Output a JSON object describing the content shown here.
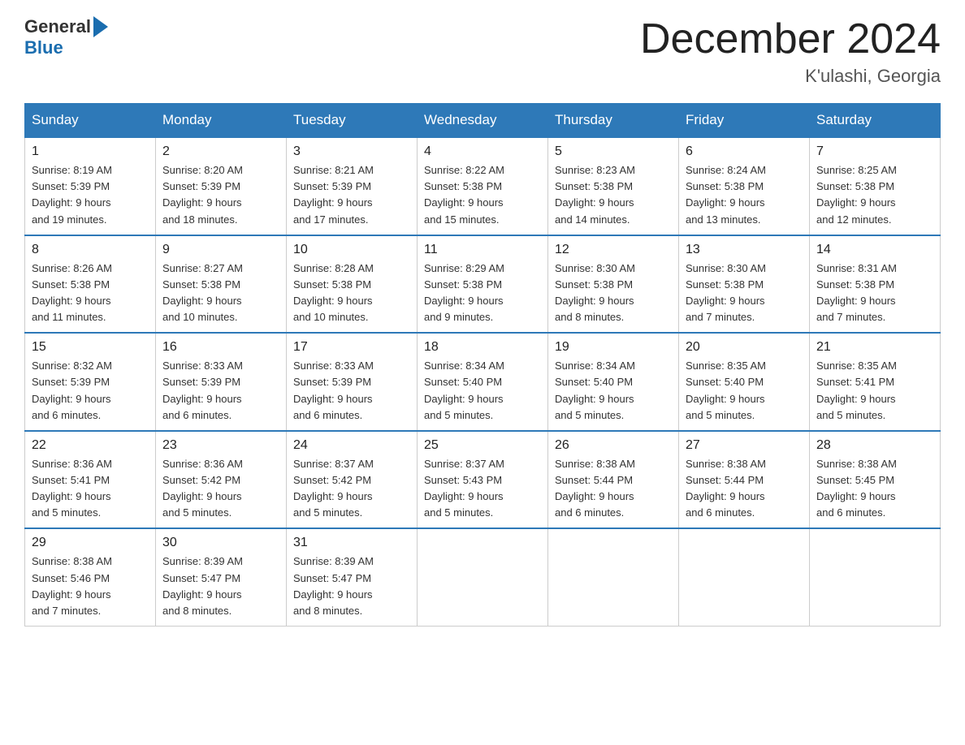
{
  "header": {
    "logo": {
      "text_general": "General",
      "text_blue": "Blue"
    },
    "title": "December 2024",
    "subtitle": "K'ulashi, Georgia"
  },
  "weekdays": [
    "Sunday",
    "Monday",
    "Tuesday",
    "Wednesday",
    "Thursday",
    "Friday",
    "Saturday"
  ],
  "weeks": [
    [
      {
        "day": "1",
        "sunrise": "8:19 AM",
        "sunset": "5:39 PM",
        "daylight": "9 hours and 19 minutes."
      },
      {
        "day": "2",
        "sunrise": "8:20 AM",
        "sunset": "5:39 PM",
        "daylight": "9 hours and 18 minutes."
      },
      {
        "day": "3",
        "sunrise": "8:21 AM",
        "sunset": "5:39 PM",
        "daylight": "9 hours and 17 minutes."
      },
      {
        "day": "4",
        "sunrise": "8:22 AM",
        "sunset": "5:38 PM",
        "daylight": "9 hours and 15 minutes."
      },
      {
        "day": "5",
        "sunrise": "8:23 AM",
        "sunset": "5:38 PM",
        "daylight": "9 hours and 14 minutes."
      },
      {
        "day": "6",
        "sunrise": "8:24 AM",
        "sunset": "5:38 PM",
        "daylight": "9 hours and 13 minutes."
      },
      {
        "day": "7",
        "sunrise": "8:25 AM",
        "sunset": "5:38 PM",
        "daylight": "9 hours and 12 minutes."
      }
    ],
    [
      {
        "day": "8",
        "sunrise": "8:26 AM",
        "sunset": "5:38 PM",
        "daylight": "9 hours and 11 minutes."
      },
      {
        "day": "9",
        "sunrise": "8:27 AM",
        "sunset": "5:38 PM",
        "daylight": "9 hours and 10 minutes."
      },
      {
        "day": "10",
        "sunrise": "8:28 AM",
        "sunset": "5:38 PM",
        "daylight": "9 hours and 10 minutes."
      },
      {
        "day": "11",
        "sunrise": "8:29 AM",
        "sunset": "5:38 PM",
        "daylight": "9 hours and 9 minutes."
      },
      {
        "day": "12",
        "sunrise": "8:30 AM",
        "sunset": "5:38 PM",
        "daylight": "9 hours and 8 minutes."
      },
      {
        "day": "13",
        "sunrise": "8:30 AM",
        "sunset": "5:38 PM",
        "daylight": "9 hours and 7 minutes."
      },
      {
        "day": "14",
        "sunrise": "8:31 AM",
        "sunset": "5:38 PM",
        "daylight": "9 hours and 7 minutes."
      }
    ],
    [
      {
        "day": "15",
        "sunrise": "8:32 AM",
        "sunset": "5:39 PM",
        "daylight": "9 hours and 6 minutes."
      },
      {
        "day": "16",
        "sunrise": "8:33 AM",
        "sunset": "5:39 PM",
        "daylight": "9 hours and 6 minutes."
      },
      {
        "day": "17",
        "sunrise": "8:33 AM",
        "sunset": "5:39 PM",
        "daylight": "9 hours and 6 minutes."
      },
      {
        "day": "18",
        "sunrise": "8:34 AM",
        "sunset": "5:40 PM",
        "daylight": "9 hours and 5 minutes."
      },
      {
        "day": "19",
        "sunrise": "8:34 AM",
        "sunset": "5:40 PM",
        "daylight": "9 hours and 5 minutes."
      },
      {
        "day": "20",
        "sunrise": "8:35 AM",
        "sunset": "5:40 PM",
        "daylight": "9 hours and 5 minutes."
      },
      {
        "day": "21",
        "sunrise": "8:35 AM",
        "sunset": "5:41 PM",
        "daylight": "9 hours and 5 minutes."
      }
    ],
    [
      {
        "day": "22",
        "sunrise": "8:36 AM",
        "sunset": "5:41 PM",
        "daylight": "9 hours and 5 minutes."
      },
      {
        "day": "23",
        "sunrise": "8:36 AM",
        "sunset": "5:42 PM",
        "daylight": "9 hours and 5 minutes."
      },
      {
        "day": "24",
        "sunrise": "8:37 AM",
        "sunset": "5:42 PM",
        "daylight": "9 hours and 5 minutes."
      },
      {
        "day": "25",
        "sunrise": "8:37 AM",
        "sunset": "5:43 PM",
        "daylight": "9 hours and 5 minutes."
      },
      {
        "day": "26",
        "sunrise": "8:38 AM",
        "sunset": "5:44 PM",
        "daylight": "9 hours and 6 minutes."
      },
      {
        "day": "27",
        "sunrise": "8:38 AM",
        "sunset": "5:44 PM",
        "daylight": "9 hours and 6 minutes."
      },
      {
        "day": "28",
        "sunrise": "8:38 AM",
        "sunset": "5:45 PM",
        "daylight": "9 hours and 6 minutes."
      }
    ],
    [
      {
        "day": "29",
        "sunrise": "8:38 AM",
        "sunset": "5:46 PM",
        "daylight": "9 hours and 7 minutes."
      },
      {
        "day": "30",
        "sunrise": "8:39 AM",
        "sunset": "5:47 PM",
        "daylight": "9 hours and 8 minutes."
      },
      {
        "day": "31",
        "sunrise": "8:39 AM",
        "sunset": "5:47 PM",
        "daylight": "9 hours and 8 minutes."
      },
      null,
      null,
      null,
      null
    ]
  ],
  "labels": {
    "sunrise": "Sunrise:",
    "sunset": "Sunset:",
    "daylight": "Daylight:"
  }
}
